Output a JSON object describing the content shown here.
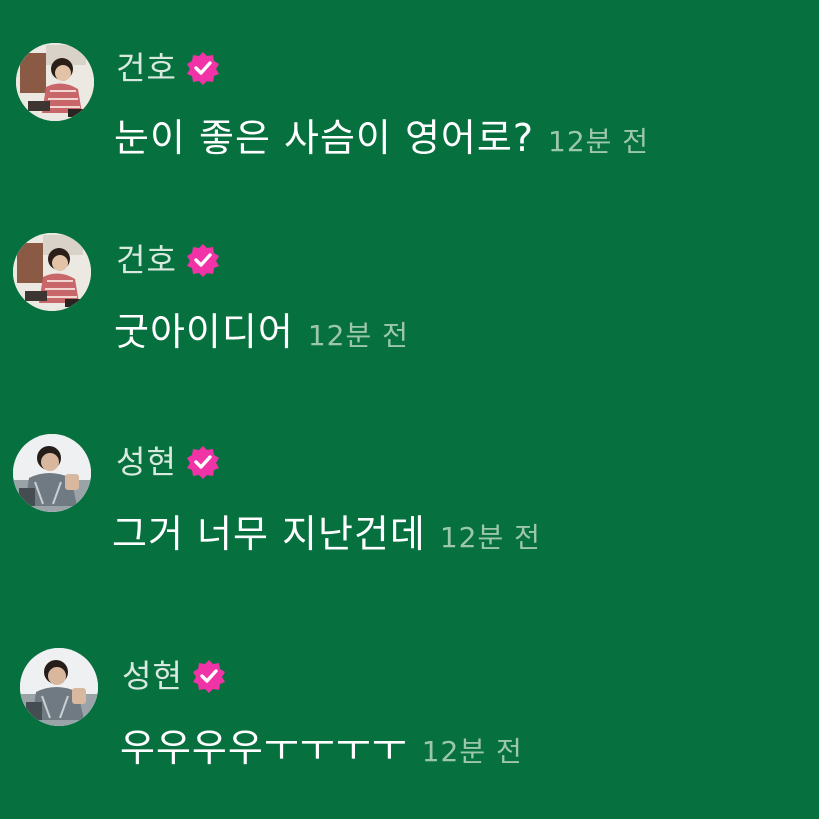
{
  "colors": {
    "background": "#07703f",
    "verified_badge": "#f033a6",
    "name_text": "#d9e9df",
    "message_text": "#ffffff",
    "timestamp_text": "#9cc7ad"
  },
  "comments": [
    {
      "author": "건호",
      "verified": true,
      "text": "눈이 좋은 사슴이 영어로?",
      "time": "12분 전",
      "avatar_icon": "user-photo-icon"
    },
    {
      "author": "건호",
      "verified": true,
      "text": "굿아이디어",
      "time": "12분 전",
      "avatar_icon": "user-photo-icon"
    },
    {
      "author": "성현",
      "verified": true,
      "text": "그거 너무 지난건데",
      "time": "12분 전",
      "avatar_icon": "user-photo-icon"
    },
    {
      "author": "성현",
      "verified": true,
      "text": "우우우우ㅜㅜㅜㅜ",
      "time": "12분 전",
      "avatar_icon": "user-photo-icon"
    }
  ]
}
